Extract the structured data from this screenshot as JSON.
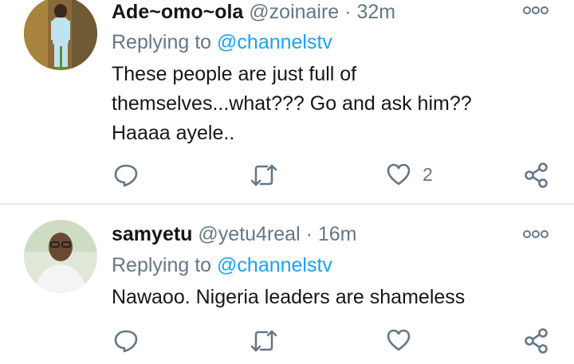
{
  "tweets": [
    {
      "name": "Ade~omo~ola",
      "handle": "@zoinaire",
      "separator": "·",
      "time": "32m",
      "replying_label": "Replying to",
      "replying_to": "@channelstv",
      "text_lines": [
        "These people are just full of",
        "themselves...what??? Go and ask him??",
        "Haaaa ayele.."
      ],
      "like_count": "2",
      "reply_count": "",
      "retweet_count": ""
    },
    {
      "name": "samyetu",
      "handle": "@yetu4real",
      "separator": "·",
      "time": "16m",
      "replying_label": "Replying to",
      "replying_to": "@channelstv",
      "text_lines": [
        "Nawaoo. Nigeria leaders are shameless"
      ],
      "like_count": "",
      "reply_count": "",
      "retweet_count": ""
    }
  ],
  "colors": {
    "text": "#14171a",
    "secondary": "#657786",
    "link": "#1da1f2",
    "divider": "#e3e7ea"
  },
  "icons": [
    "reply-icon",
    "retweet-icon",
    "like-icon",
    "share-icon",
    "more-icon"
  ]
}
